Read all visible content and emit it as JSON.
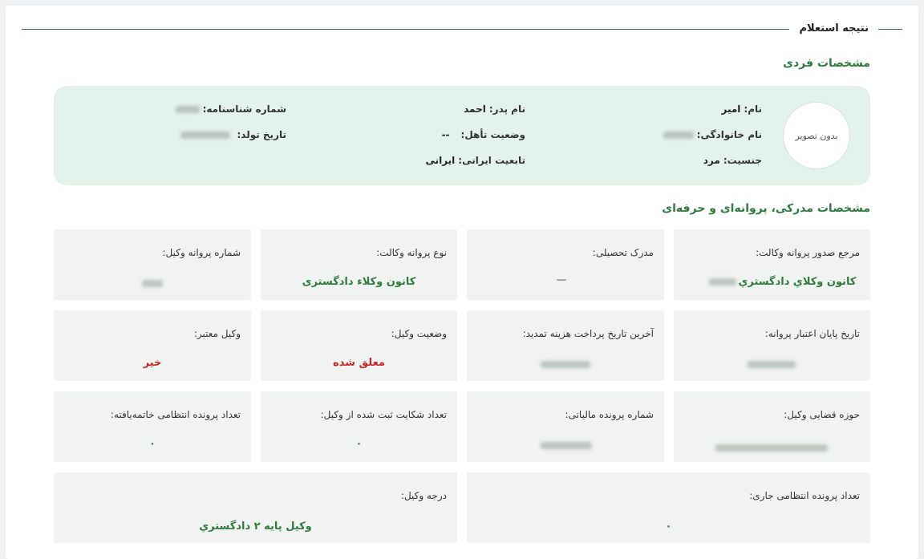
{
  "inquiry_result_title": "نتیجه استعلام",
  "personal": {
    "section_title": "مشخصات فردی",
    "avatar_text": "بدون تصویر",
    "name_label": "نام:",
    "name_value": "امیر",
    "lastname_label": "نام خانوادگی:",
    "gender_label": "جنسیت:",
    "gender_value": "مرد",
    "father_label": "نام پدر:",
    "father_value": "احمد",
    "marital_label": "وضعیت تأهل:",
    "marital_value": "--",
    "nationality_label": "تابعیت ایرانی:",
    "nationality_value": "ایرانی",
    "id_number_label": "شماره شناسنامه:",
    "birthdate_label": "تاریخ تولد:"
  },
  "professional": {
    "section_title": "مشخصات مدرکی، پروانه‌ای و حرفه‌ای",
    "tiles": [
      {
        "label": "مرجع صدور پروانه وکالت:",
        "value": "کانون وكلاي دادگستري"
      },
      {
        "label": "مدرک تحصیلی:",
        "value": "—"
      },
      {
        "label": "نوع پروانه وکالت:",
        "value": "کانون وکلاء دادگستری"
      },
      {
        "label": "شماره پروانه وکیل:"
      },
      {
        "label": "تاریخ پایان اعتبار پروانه:"
      },
      {
        "label": "آخرین تاریخ پرداخت هزینه تمدید:"
      },
      {
        "label": "وضعیت وکیل:",
        "value": "معلق شده"
      },
      {
        "label": "وکیل معتبر:",
        "value": "خیر"
      },
      {
        "label": "حوزه قضایی وکیل:"
      },
      {
        "label": "شماره پرونده مالیاتی:"
      },
      {
        "label": "تعداد شکایت ثبت شده از وکیل:",
        "value": "۰"
      },
      {
        "label": "تعداد پرونده انتظامی خاتمه‌یافته:",
        "value": "۰"
      },
      {
        "label": "تعداد پرونده انتظامی جاری:",
        "value": "۰"
      },
      {
        "label": "درجه وکیل:",
        "value": "وکیل پایه ۲ دادگستري"
      }
    ]
  },
  "colors": {
    "accent_green": "#2f7a3e",
    "status_red": "#c62828",
    "personal_box_bg": "#e3f2ea",
    "tile_bg": "#f0f3f1"
  }
}
